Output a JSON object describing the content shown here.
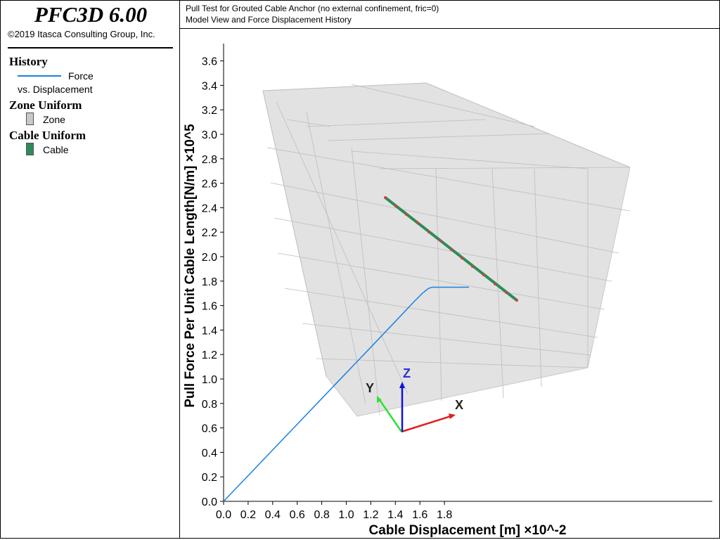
{
  "app": {
    "title": "PFC3D 6.00",
    "copyright": "©2019 Itasca Consulting Group, Inc."
  },
  "legend": {
    "history_heading": "History",
    "history_item_line1": "Force",
    "history_item_line2": "vs. Displacement",
    "history_color": "#1a82e0",
    "zone_heading": "Zone Uniform",
    "zone_item": "Zone",
    "zone_color": "#c8c8c8",
    "cable_heading": "Cable Uniform",
    "cable_item": "Cable",
    "cable_color": "#2e8b57"
  },
  "header": {
    "line1": "Pull Test for Grouted Cable Anchor (no external confinement, fric=0)",
    "line2": "Model View and Force Displacement History"
  },
  "model_view": {
    "axis_labels": {
      "x": "X",
      "y": "Y",
      "z": "Z"
    },
    "axis_colors": {
      "x": "#e02020",
      "y": "#30e030",
      "z": "#1010e0"
    }
  },
  "chart_data": {
    "type": "line",
    "xlabel": "Cable Displacement [m] ×10^-2",
    "ylabel": "Pull Force Per Unit Cable Length[N/m] ×10^5",
    "xlim": [
      0,
      2.0
    ],
    "ylim": [
      0,
      3.8
    ],
    "x_ticks": [
      "0.0",
      "0.2",
      "0.4",
      "0.6",
      "0.8",
      "1.0",
      "1.2",
      "1.4",
      "1.6",
      "1.8"
    ],
    "y_ticks": [
      "0.0",
      "0.2",
      "0.4",
      "0.6",
      "0.8",
      "1.0",
      "1.2",
      "1.4",
      "1.6",
      "1.8",
      "2.0",
      "2.2",
      "2.4",
      "2.6",
      "2.8",
      "3.0",
      "3.2",
      "3.4",
      "3.6"
    ],
    "series": [
      {
        "name": "Force vs. Displacement",
        "color": "#1a82e0",
        "x": [
          0.0,
          0.2,
          0.4,
          0.6,
          0.8,
          1.0,
          1.2,
          1.4,
          1.55,
          1.62,
          1.67,
          1.7,
          1.8,
          2.0
        ],
        "y": [
          0.0,
          0.21,
          0.42,
          0.63,
          0.84,
          1.05,
          1.26,
          1.47,
          1.63,
          1.7,
          1.74,
          1.75,
          1.75,
          1.75
        ]
      }
    ]
  }
}
